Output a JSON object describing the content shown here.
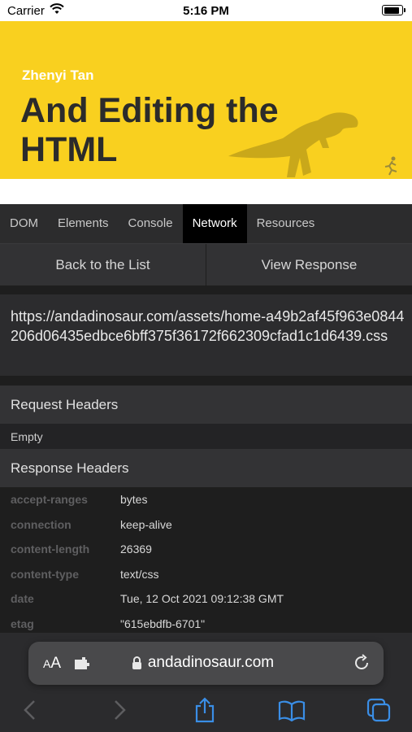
{
  "status": {
    "carrier": "Carrier",
    "time": "5:16 PM"
  },
  "hero": {
    "author": "Zhenyi Tan",
    "title": "And Editing the HTML"
  },
  "tabs": [
    {
      "label": "DOM",
      "active": false
    },
    {
      "label": "Elements",
      "active": false
    },
    {
      "label": "Console",
      "active": false
    },
    {
      "label": "Network",
      "active": true
    },
    {
      "label": "Resources",
      "active": false
    }
  ],
  "actions": {
    "back": "Back to the List",
    "view": "View Response"
  },
  "request_url": "https://andadinosaur.com/assets/home-a49b2af45f963e0844206d06435edbce6bff375f36172f662309cfad1c1d6439.css",
  "request_headers": {
    "title": "Request Headers",
    "empty": "Empty"
  },
  "response_headers": {
    "title": "Response Headers",
    "rows": [
      {
        "key": "accept-ranges",
        "value": "bytes"
      },
      {
        "key": "connection",
        "value": "keep-alive"
      },
      {
        "key": "content-length",
        "value": "26369"
      },
      {
        "key": "content-type",
        "value": "text/css"
      },
      {
        "key": "date",
        "value": "Tue, 12 Oct 2021 09:12:38 GMT"
      },
      {
        "key": "etag",
        "value": "\"615ebdfb-6701\""
      }
    ]
  },
  "toolbar": {
    "aa_small": "A",
    "aa_big": "A",
    "domain": "andadinosaur.com"
  },
  "colors": {
    "hero_bg": "#f9d01f",
    "accent_blue": "#3a8ee6",
    "active_tab_bg": "#000000"
  }
}
